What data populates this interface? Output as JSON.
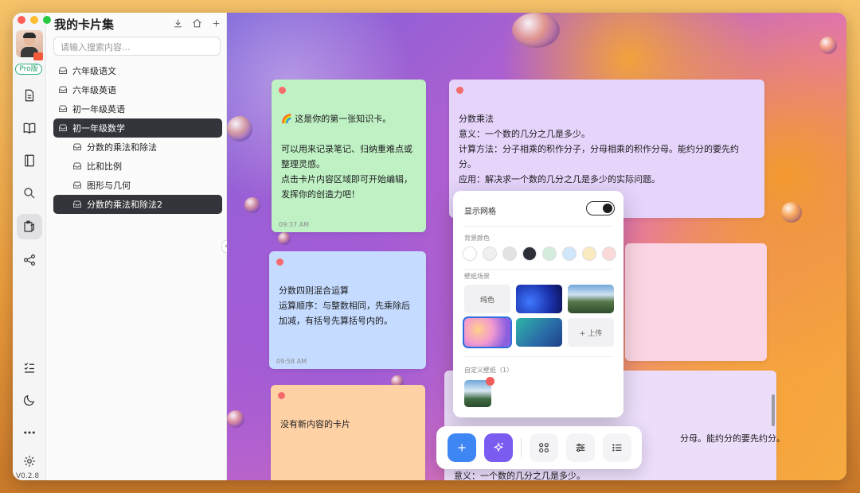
{
  "app": {
    "title": "我的卡片集",
    "pro_label": "Pro版",
    "version": "V0.2.8"
  },
  "search": {
    "placeholder": "请输入搜索内容..."
  },
  "tree": [
    {
      "label": "六年级语文",
      "child": false,
      "selected": false
    },
    {
      "label": "六年级英语",
      "child": false,
      "selected": false
    },
    {
      "label": "初一年级英语",
      "child": false,
      "selected": false
    },
    {
      "label": "初一年级数学",
      "child": false,
      "selected": true
    },
    {
      "label": "分数的乘法和除法",
      "child": true,
      "selected": false
    },
    {
      "label": "比和比例",
      "child": true,
      "selected": false
    },
    {
      "label": "图形与几何",
      "child": true,
      "selected": false
    },
    {
      "label": "分数的乘法和除法2",
      "child": true,
      "selected": true
    }
  ],
  "cards": {
    "green": {
      "lines": [
        "🌈 这是你的第一张知识卡。",
        "",
        "可以用来记录笔记、归纳重难点或整理灵感。",
        "点击卡片内容区域即可开始编辑，发挥你的创造力吧！"
      ],
      "time": "09:37 AM"
    },
    "purple_top": {
      "lines": [
        "分数乘法",
        "意义：一个数的几分之几是多少。",
        "计算方法：分子相乘的积作分子，分母相乘的积作分母。能约分的要先约分。",
        "应用：解决求一个数的几分之几是多少的实际问题。"
      ]
    },
    "blue": {
      "lines": [
        "分数四则混合运算",
        "运算顺序：与整数相同，先乘除后加减，有括号先算括号内的。"
      ],
      "time": "09:58 AM"
    },
    "orange": {
      "lines": [
        "没有新内容的卡片"
      ]
    },
    "purple_bottom": {
      "lines": [
        "分母。能约分的要先约分。",
        "意义：一个数的几分之几是多少。"
      ]
    }
  },
  "popover": {
    "show_grid_label": "显示网格",
    "bg_color_label": "背景颜色",
    "wallpaper_label": "壁纸场景",
    "solid_label": "纯色",
    "upload_label": "+ 上传",
    "custom_label": "自定义壁纸（1）",
    "colors": [
      "#ffffff",
      "#f0f0f0",
      "#e2e2e2",
      "#2c2f38",
      "#d3ecdc",
      "#cfe6fb",
      "#fbeabf",
      "#fbd9d9"
    ]
  },
  "icons": {
    "rail": [
      "document-icon",
      "book-icon",
      "notebook-icon",
      "search-icon",
      "clipboard-icon",
      "share-icon",
      "checklist-icon",
      "moon-icon",
      "more-icon",
      "gear-icon"
    ],
    "sidebar_actions": [
      "download-icon",
      "home-icon",
      "plus-icon"
    ],
    "toolbar": [
      "plus-icon",
      "sparkle-icon",
      "grid-icon",
      "sliders-icon",
      "list-icon"
    ]
  }
}
